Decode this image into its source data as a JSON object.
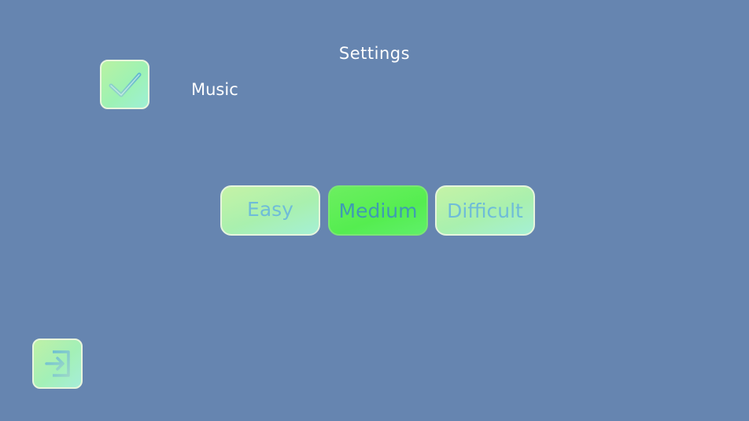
{
  "screen": {
    "title": "Settings"
  },
  "music": {
    "label": "Music",
    "checked": true,
    "icon": "checkmark-icon"
  },
  "difficulty": {
    "options": [
      "Easy",
      "Medium",
      "Difficult"
    ],
    "selected": "Medium"
  },
  "exit": {
    "icon": "exit-icon"
  },
  "colors": {
    "background": "#6685b0",
    "button_light": "#b3f2b0",
    "button_selected": "#55ed50",
    "button_text": "#6fbcd8"
  }
}
